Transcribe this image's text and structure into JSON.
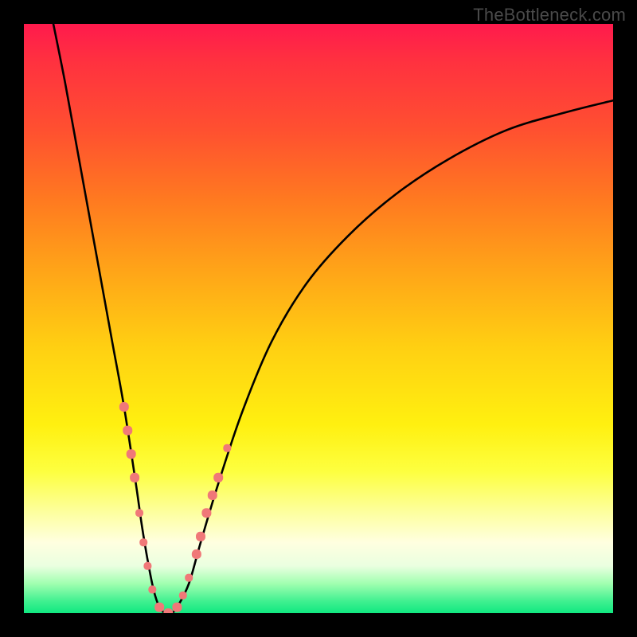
{
  "watermark": "TheBottleneck.com",
  "chart_data": {
    "type": "line",
    "title": "",
    "xlabel": "",
    "ylabel": "",
    "xlim": [
      0,
      100
    ],
    "ylim": [
      0,
      100
    ],
    "series": [
      {
        "name": "bottleneck-curve",
        "x": [
          5,
          7,
          9,
          11,
          13,
          15,
          17,
          19,
          20,
          21,
          22,
          23,
          24,
          25,
          26,
          28,
          30,
          33,
          37,
          42,
          48,
          55,
          63,
          72,
          82,
          92,
          100
        ],
        "values": [
          100,
          90,
          79,
          68,
          57,
          46,
          35,
          22,
          15,
          9,
          4,
          1,
          0,
          0,
          1,
          5,
          12,
          22,
          34,
          46,
          56,
          64,
          71,
          77,
          82,
          85,
          87
        ]
      }
    ],
    "markers": {
      "name": "highlight-points",
      "color": "#f07878",
      "points": [
        {
          "x": 17.0,
          "y": 35,
          "size": 12
        },
        {
          "x": 17.6,
          "y": 31,
          "size": 12
        },
        {
          "x": 18.2,
          "y": 27,
          "size": 12
        },
        {
          "x": 18.8,
          "y": 23,
          "size": 12
        },
        {
          "x": 19.6,
          "y": 17,
          "size": 10
        },
        {
          "x": 20.3,
          "y": 12,
          "size": 10
        },
        {
          "x": 21.0,
          "y": 8,
          "size": 10
        },
        {
          "x": 21.8,
          "y": 4,
          "size": 10
        },
        {
          "x": 23.0,
          "y": 1,
          "size": 12
        },
        {
          "x": 24.5,
          "y": 0,
          "size": 12
        },
        {
          "x": 26.0,
          "y": 1,
          "size": 12
        },
        {
          "x": 27.0,
          "y": 3,
          "size": 10
        },
        {
          "x": 28.0,
          "y": 6,
          "size": 10
        },
        {
          "x": 29.3,
          "y": 10,
          "size": 12
        },
        {
          "x": 30.0,
          "y": 13,
          "size": 12
        },
        {
          "x": 31.0,
          "y": 17,
          "size": 12
        },
        {
          "x": 32.0,
          "y": 20,
          "size": 12
        },
        {
          "x": 33.0,
          "y": 23,
          "size": 12
        },
        {
          "x": 34.5,
          "y": 28,
          "size": 10
        }
      ]
    },
    "gradient_stops": [
      {
        "pos": 0,
        "color": "#ff1a4d"
      },
      {
        "pos": 18,
        "color": "#ff5030"
      },
      {
        "pos": 42,
        "color": "#ffa518"
      },
      {
        "pos": 68,
        "color": "#fff010"
      },
      {
        "pos": 88,
        "color": "#ffffe0"
      },
      {
        "pos": 100,
        "color": "#10e880"
      }
    ]
  }
}
